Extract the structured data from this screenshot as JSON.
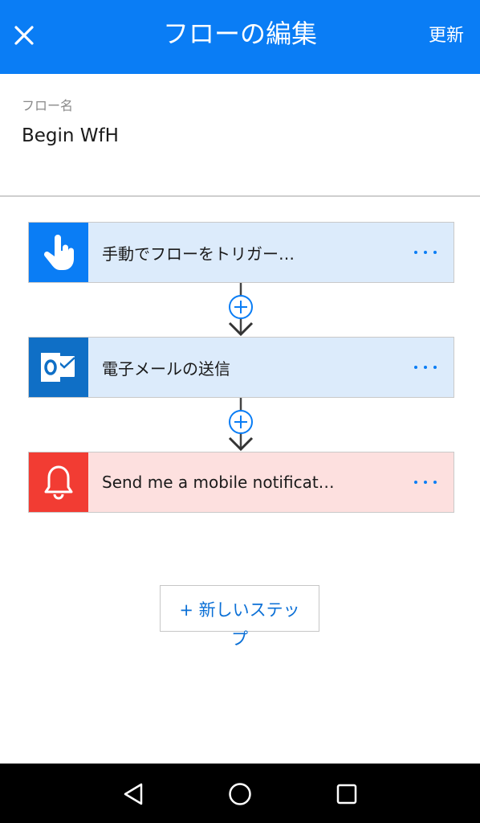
{
  "appbar": {
    "title": "フローの編集",
    "update_label": "更新",
    "close_icon": "close-icon",
    "color": "#0a7df5"
  },
  "flow": {
    "name_label": "フロー名",
    "name_value": "Begin WfH"
  },
  "steps": [
    {
      "label": "手動でフローをトリガー…",
      "icon": "touch-icon",
      "icon_bg": "#0a7df5",
      "card_bg": "#dcebfb"
    },
    {
      "label": "電子メールの送信",
      "icon": "outlook-icon",
      "icon_bg": "#0f6fc6",
      "card_bg": "#dcebfb"
    },
    {
      "label": "Send me a mobile notificat…",
      "icon": "bell-icon",
      "icon_bg": "#f23c33",
      "card_bg": "#fde0df"
    }
  ],
  "new_step": {
    "label_line1": "+ 新しいステッ",
    "label_line2": "プ"
  },
  "navbar": {
    "back_icon": "back-triangle-icon",
    "home_icon": "home-circle-icon",
    "recents_icon": "recents-square-icon"
  }
}
